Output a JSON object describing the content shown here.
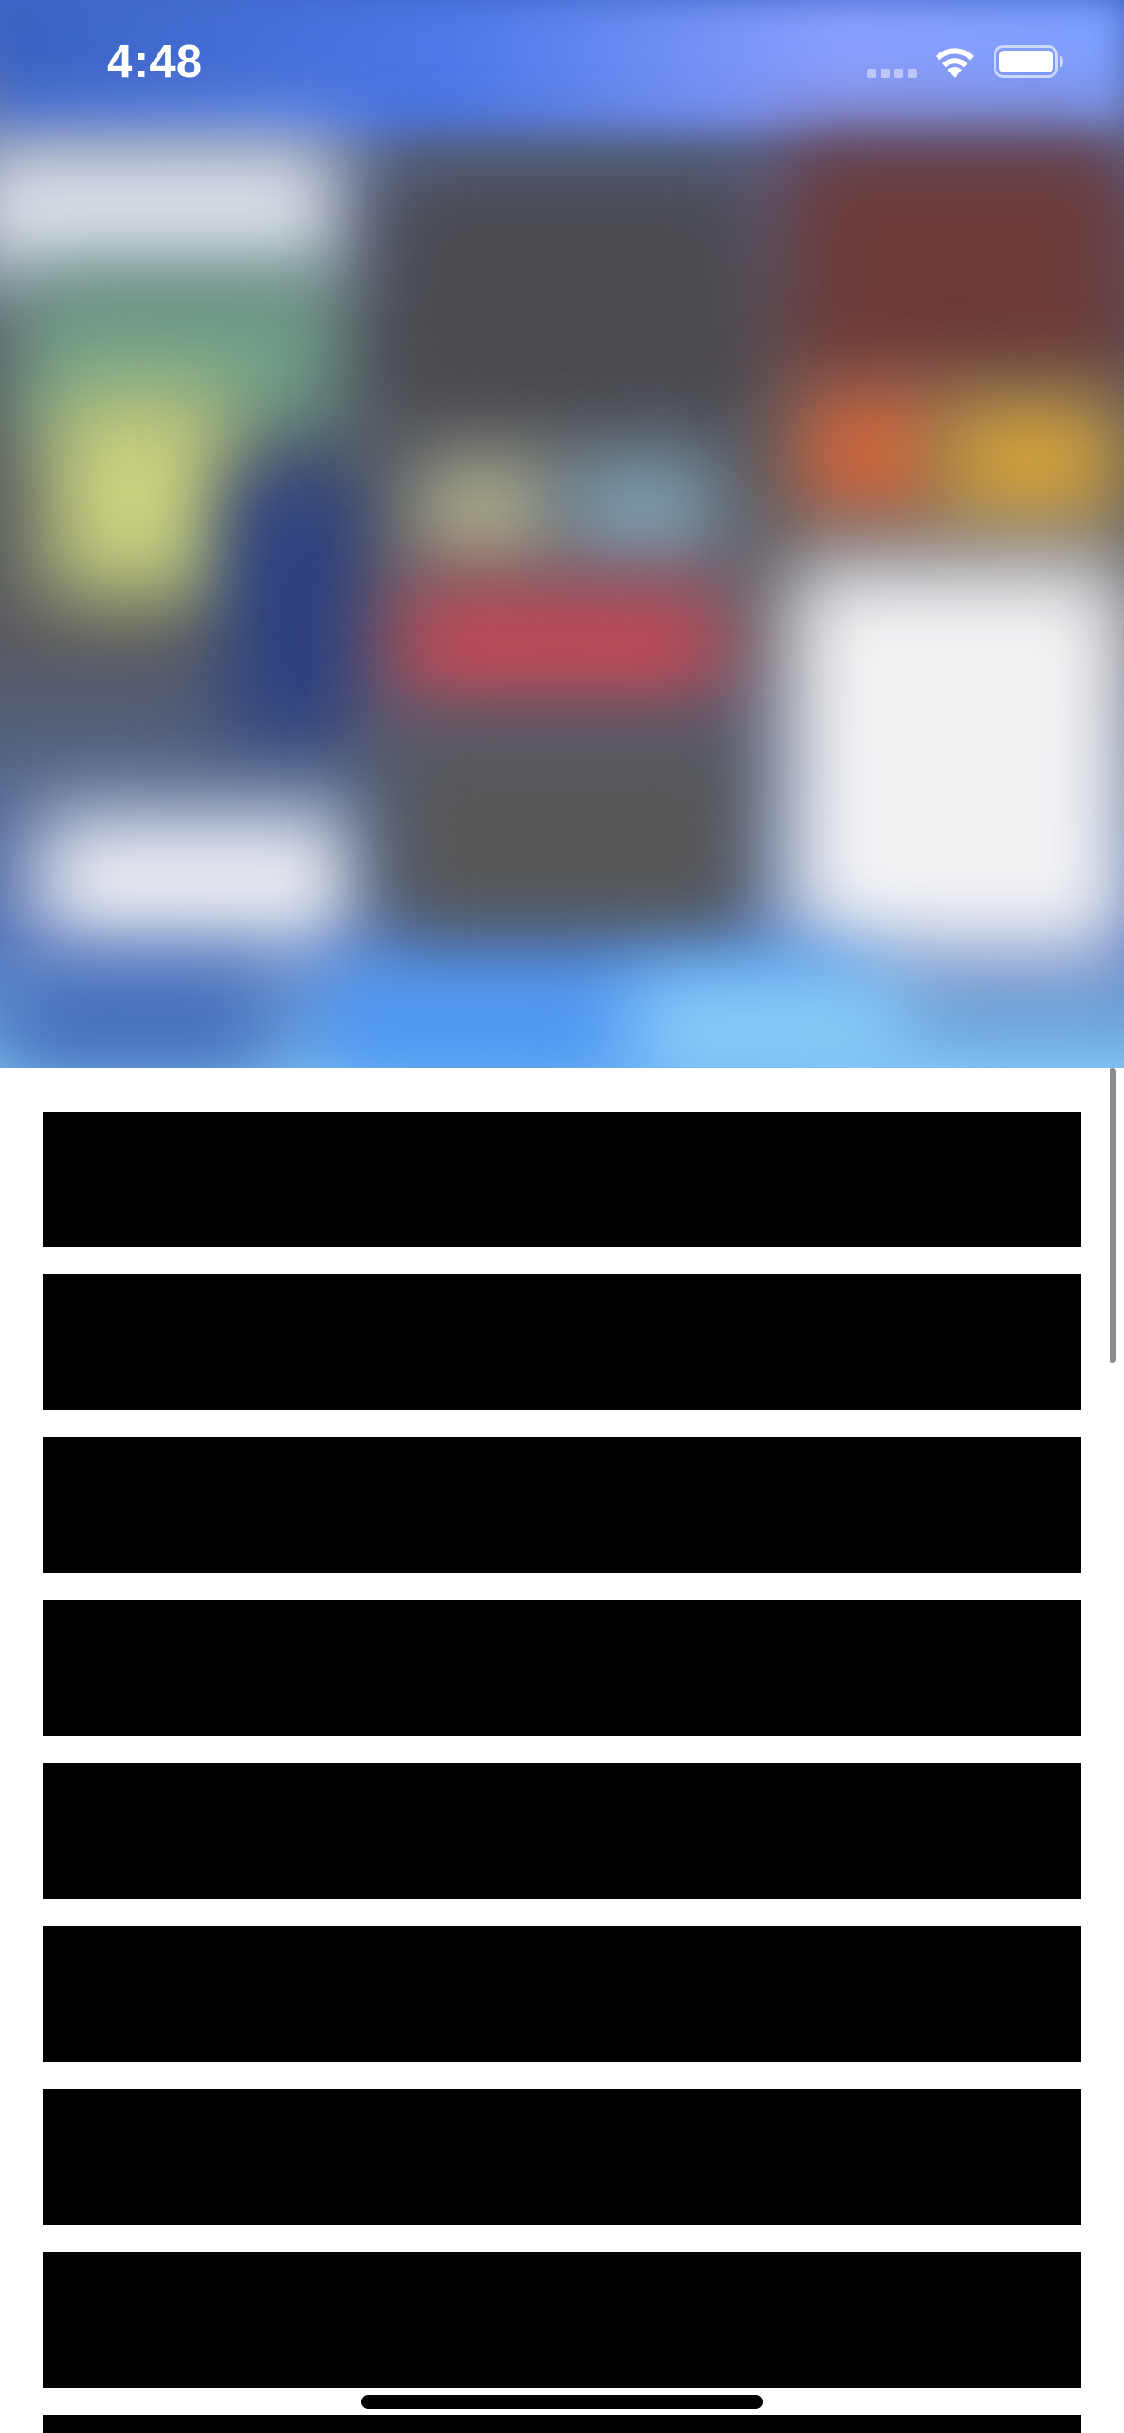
{
  "status_bar": {
    "time": "4:48",
    "icons": [
      "cellular-signal-icon",
      "wifi-icon",
      "battery-icon"
    ]
  },
  "hero": {
    "content": "blurred-image"
  },
  "list": {
    "row_color": "#000000",
    "rows": [
      {
        "id": 1
      },
      {
        "id": 2
      },
      {
        "id": 3
      },
      {
        "id": 4
      },
      {
        "id": 5
      },
      {
        "id": 6
      },
      {
        "id": 7
      },
      {
        "id": 8
      },
      {
        "id": 9
      }
    ]
  },
  "colors": {
    "background": "#ffffff",
    "status_text": "#ffffff"
  }
}
